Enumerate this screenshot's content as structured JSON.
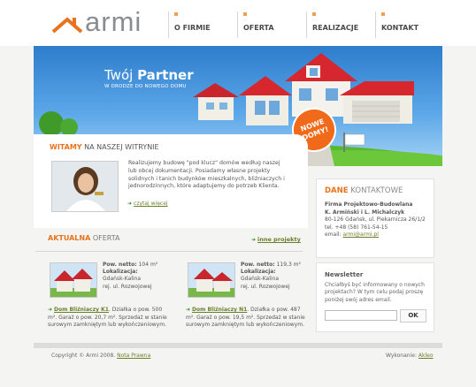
{
  "brand": {
    "name": "armi",
    "accent": "#e8731e",
    "link_color": "#6b7f2a"
  },
  "nav": {
    "items": [
      {
        "label": "O FIRMIE"
      },
      {
        "label": "OFERTA"
      },
      {
        "label": "REALIZACJE"
      },
      {
        "label": "KONTAKT"
      }
    ]
  },
  "banner": {
    "title_light": "Twój ",
    "title_bold": "Partner",
    "subtitle": "W DRODZE DO NOWEGO DOMU",
    "badge_line1": "NOWE",
    "badge_line2": "DOMY!"
  },
  "welcome": {
    "heading_bold": "WITAMY",
    "heading_rest": " NA NASZEJ WITRYNIE",
    "paragraph1": "Realizujemy budowę \"pod klucz\" domów według naszej lub obcej dokumentacji. Posiadamy własne projekty solidnych i tanich budynków mieszkalnych, bliźniaczych i jednorodzinnych, które adaptujemy do potrzeb Klienta.",
    "more_link": "czytaj więcej"
  },
  "offers": {
    "heading_bold": "AKTUALNA",
    "heading_rest": " OFERTA",
    "other_link": "inne projekty",
    "items": [
      {
        "area_label": "Pow. netto:",
        "area_value": "104 m²",
        "location_label": "Lokalizacja:",
        "location_city": "Gdańsk-Kalina",
        "location_street": "rej. ul. Rozwojowej",
        "link": "Dom Bliźniaczy K1",
        "desc": ". Działka o pow. 500 m². Garaż o pow. 20,7 m². Sprzedaż w stanie surowym zamkniętym lub wykończeniowym."
      },
      {
        "area_label": "Pow. netto:",
        "area_value": "119,3 m²",
        "location_label": "Lokalizacja:",
        "location_city": "Gdańsk-Kalina",
        "location_street": "rej. ul. Rozwojowej",
        "link": "Dom Bliźniaczy N1",
        "desc": ". Działka o pow. 487 m². Garaż o pow. 19,5 m². Sprzedaż w stanie surowym zamkniętym lub wykończeniowym."
      }
    ]
  },
  "contact": {
    "heading_bold": "DANE",
    "heading_rest": " KONTAKTOWE",
    "company": "Firma Projektowo-Budowlana",
    "owners": "K. Armiński i L. Michalczyk",
    "address": "80-126 Gdańsk, ul. Piekarnicza 26/1/2",
    "phone": "tel. +48 (58) 761-54-15",
    "email_label": "email: ",
    "email": "armi@armi.pl"
  },
  "newsletter": {
    "title": "Newsletter",
    "text": "Chciałbyś być informowany o nowych projektach? W tym celu podaj proszę poniżej swój adres email.",
    "input_value": "",
    "button": "OK"
  },
  "footer": {
    "copyright": "Copyright © Armi 2008. ",
    "legal_link": "Nota Prawna",
    "made_by_label": "Wykonanie: ",
    "made_by_link": "Akleo"
  }
}
